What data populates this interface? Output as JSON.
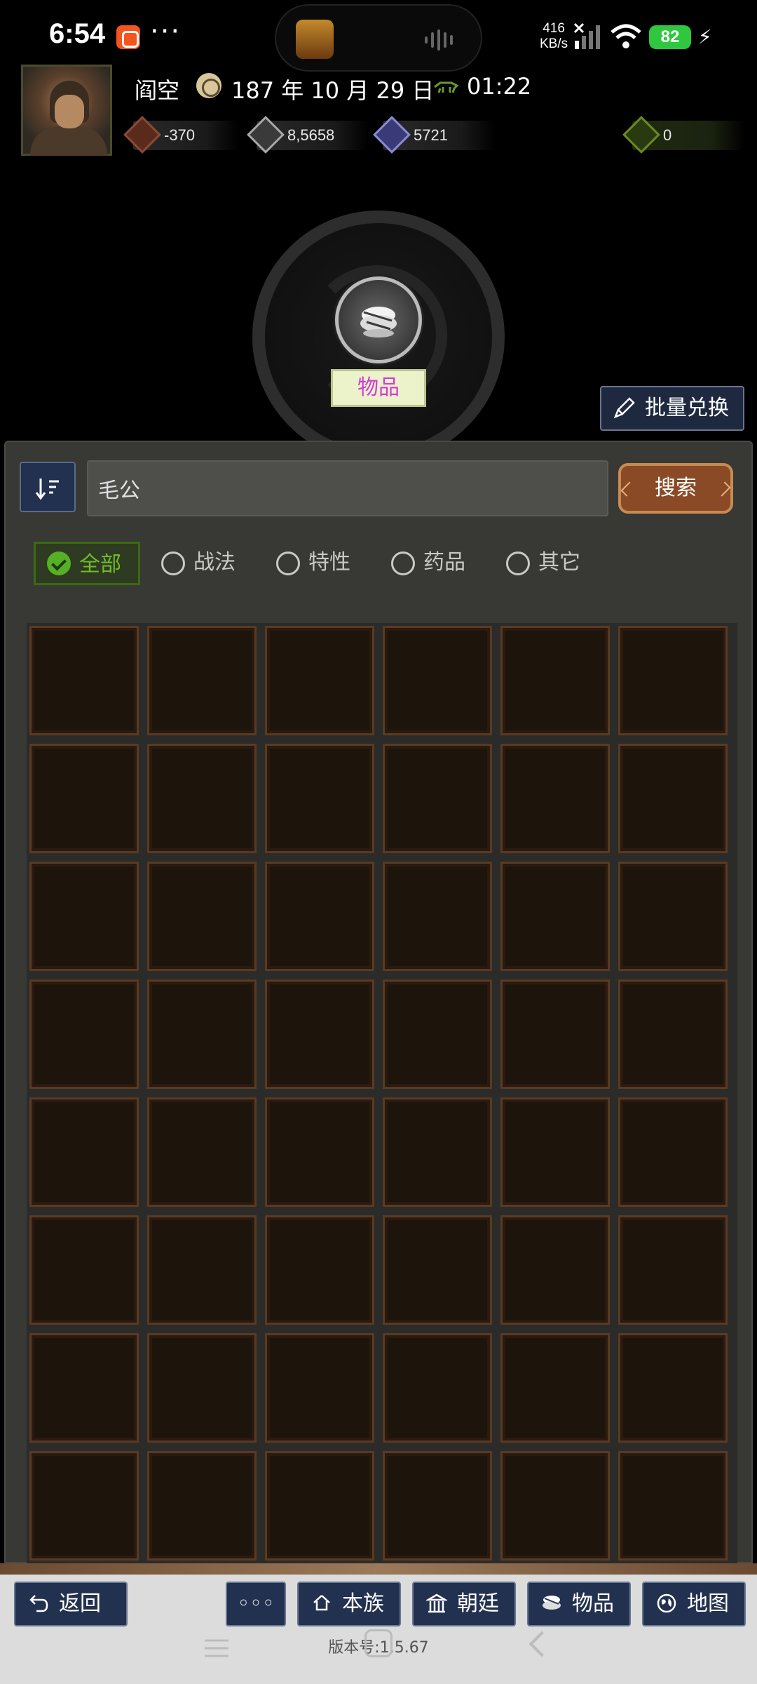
{
  "status_bar": {
    "time": "6:54",
    "network_speed_value": "416",
    "network_speed_unit": "KB/s",
    "battery": "82"
  },
  "player": {
    "name": "阎空",
    "date": "187 年 10 月 29 日",
    "clock": "01:22"
  },
  "resources": {
    "money": "-370",
    "food": "8,5658",
    "troops": "5721",
    "gold": "0"
  },
  "center": {
    "section_label": "物品"
  },
  "batch_exchange_label": "批量兑换",
  "search": {
    "value": "毛公",
    "button_label": "搜索"
  },
  "filters": [
    {
      "label": "全部",
      "selected": true
    },
    {
      "label": "战法",
      "selected": false
    },
    {
      "label": "特性",
      "selected": false
    },
    {
      "label": "药品",
      "selected": false
    },
    {
      "label": "其它",
      "selected": false
    }
  ],
  "nav": {
    "back": "返回",
    "more": "◦◦◦",
    "clan": "本族",
    "court": "朝廷",
    "items": "物品",
    "map": "地图"
  },
  "version": "版本号:1.5.67",
  "colors": {
    "accent_green": "#56b026",
    "label_magenta": "#d23ad8",
    "nav_blue": "#233150",
    "search_brown": "#8a4a26"
  }
}
